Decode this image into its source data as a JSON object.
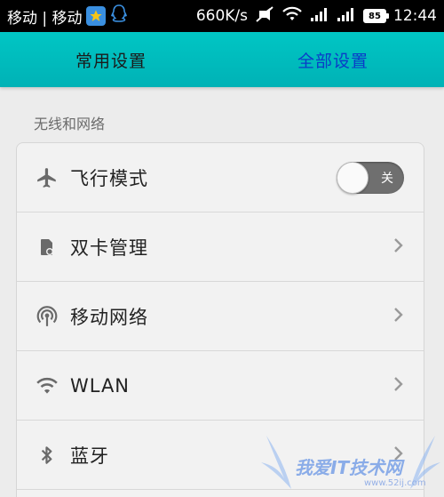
{
  "status_bar": {
    "carrier": "移动 | 移动",
    "net_speed": "660K/s",
    "battery": "85",
    "time": "12:44"
  },
  "tabs": [
    {
      "label": "常用设置",
      "active": false
    },
    {
      "label": "全部设置",
      "active": true
    }
  ],
  "section": {
    "title": "无线和网络"
  },
  "rows": [
    {
      "label": "飞行模式",
      "icon": "airplane-icon",
      "control": "toggle",
      "toggle_text": "关",
      "on": false
    },
    {
      "label": "双卡管理",
      "icon": "dual-sim-icon",
      "control": "chevron"
    },
    {
      "label": "移动网络",
      "icon": "cellular-antenna-icon",
      "control": "chevron"
    },
    {
      "label": "WLAN",
      "icon": "wifi-icon",
      "control": "chevron"
    },
    {
      "label": "蓝牙",
      "icon": "bluetooth-icon",
      "control": "chevron"
    }
  ],
  "watermark": {
    "text": "我爱IT技术网",
    "url": "www.52ij.com"
  },
  "colors": {
    "tab_bar": "#00bcbd",
    "active_tab": "#0a3cc8",
    "background": "#ececec",
    "toggle_off": "#6f6f6f"
  }
}
